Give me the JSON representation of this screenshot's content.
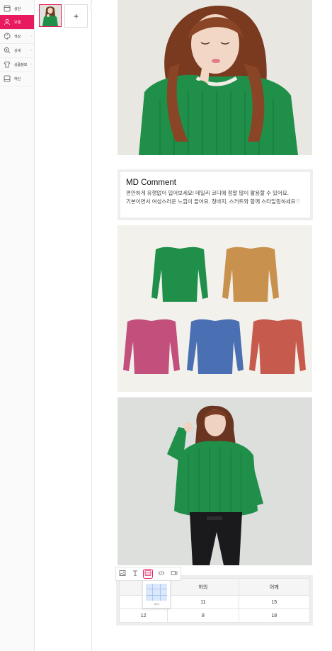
{
  "sidebar": {
    "items": [
      {
        "label": "상단",
        "icon": "top-section-icon",
        "chevron": "",
        "active": false
      },
      {
        "label": "모델",
        "icon": "model-person-icon",
        "chevron": "",
        "active": true
      },
      {
        "label": "색상",
        "icon": "palette-icon",
        "chevron": "›",
        "active": false
      },
      {
        "label": "상세",
        "icon": "zoom-detail-icon",
        "chevron": "›",
        "active": false
      },
      {
        "label": "상품정보",
        "icon": "shirt-icon",
        "chevron": "›",
        "active": false
      },
      {
        "label": "하단",
        "icon": "bottom-section-icon",
        "chevron": "",
        "active": false
      }
    ]
  },
  "thumbpanel": {
    "add_label": "+",
    "collapse_label": "‹"
  },
  "md_comment": {
    "title": "MD Comment",
    "line1": "편안하게 유행없이 입어보세요! 데일리 코디에 정말 많이 활용할 수 있어요.",
    "line2": "기본이면서 여성스러운 느낌이 들어요. 청바지, 스커트와 함께 스타일링하세요♡"
  },
  "toolbar": {
    "buttons": [
      "image-icon",
      "text-icon",
      "table-icon",
      "code-icon",
      "video-icon"
    ],
    "active": "table-icon",
    "grid_label": "3X3"
  },
  "size_table": {
    "header": [
      "",
      "하의",
      "어깨"
    ],
    "rows": [
      [
        "",
        "11",
        "15"
      ],
      [
        "12",
        "8",
        "18"
      ]
    ]
  },
  "colors": {
    "accent": "#e8195e",
    "sweater_colors": [
      "#1f8f4a",
      "#c8914d",
      "#c24f7c",
      "#4a6fb3",
      "#c55a4d"
    ]
  }
}
